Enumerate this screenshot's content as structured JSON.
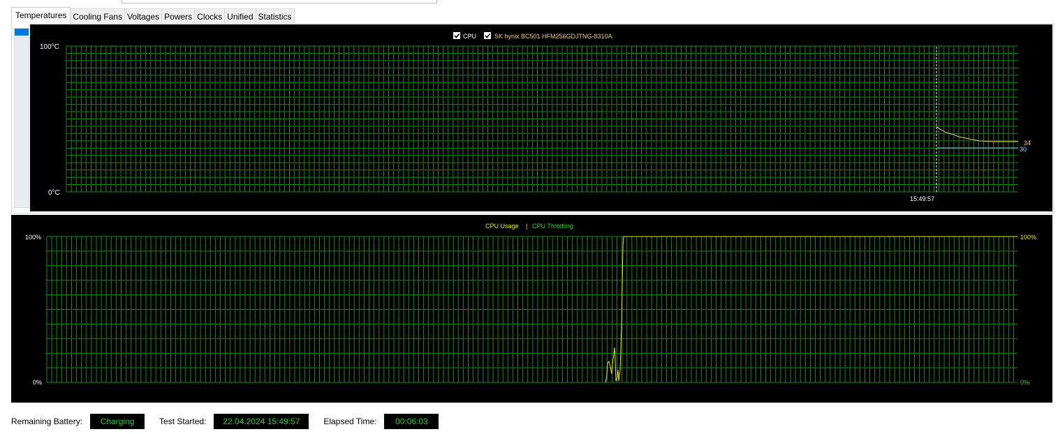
{
  "tabs": [
    {
      "label": "Temperatures",
      "active": true
    },
    {
      "label": "Cooling Fans",
      "active": false
    },
    {
      "label": "Voltages",
      "active": false
    },
    {
      "label": "Powers",
      "active": false
    },
    {
      "label": "Clocks",
      "active": false
    },
    {
      "label": "Unified",
      "active": false
    },
    {
      "label": "Statistics",
      "active": false
    }
  ],
  "temperature_graph": {
    "legend": [
      {
        "label": "CPU",
        "checked": true,
        "color": "#ffffff"
      },
      {
        "label": "SK hynix BC501 HFM256GDJTNG-8310A",
        "checked": true,
        "color": "#f0c86e"
      }
    ],
    "y_max_label": "100°C",
    "y_min_label": "0°C",
    "time_label": "15:49:57",
    "end_values": [
      {
        "text": "34",
        "color": "#f0c86e"
      },
      {
        "text": "30",
        "color": "#8fdcff"
      }
    ]
  },
  "usage_graph": {
    "legend_usage": "CPU Usage",
    "legend_separator": "|",
    "legend_throttling": "CPU Throttling",
    "left_max": "100%",
    "left_min": "0%",
    "right_max": "100%",
    "right_min": "0%"
  },
  "status": {
    "battery_label": "Remaining Battery:",
    "battery_value": "Charging",
    "test_started_label": "Test Started:",
    "test_started_value": "22.04.2024 15:49:57",
    "elapsed_label": "Elapsed Time:",
    "elapsed_value": "00:06:03"
  },
  "colors": {
    "grid": "#138a13",
    "graph_bg": "#000000",
    "cpu_usage": "#e8e800",
    "throttling": "#1ecf2c",
    "ssd_temp": "#f0c86e",
    "cpu_temp": "#8fdcff"
  },
  "chart_data": [
    {
      "type": "line",
      "title": "",
      "ylabel": "",
      "ylim": [
        0,
        100
      ],
      "series": [
        {
          "name": "CPU",
          "values": [
            30,
            30,
            30,
            30,
            30
          ]
        },
        {
          "name": "SK hynix BC501 HFM256GDJTNG-8310A",
          "values": [
            45,
            42,
            40,
            37,
            35,
            34
          ]
        }
      ]
    },
    {
      "type": "line",
      "title": "",
      "ylim": [
        0,
        100
      ],
      "series": [
        {
          "name": "CPU Usage",
          "values": [
            0,
            14,
            10,
            0,
            22,
            0,
            5,
            100,
            100,
            100,
            100
          ]
        },
        {
          "name": "CPU Throttling",
          "values": [
            0,
            0,
            0,
            0,
            0
          ]
        }
      ]
    }
  ]
}
